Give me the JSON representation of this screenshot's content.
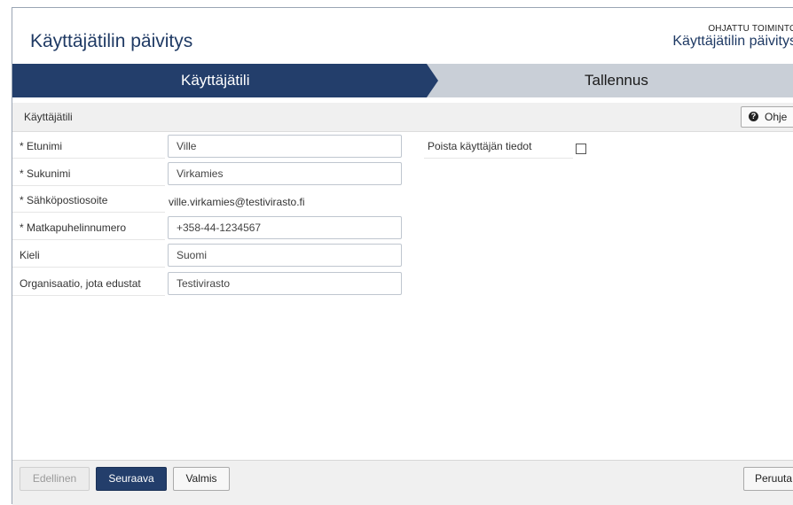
{
  "header": {
    "title": "Käyttäjätilin päivitys",
    "guided_label": "OHJATTU TOIMINTO",
    "guided_subtitle": "Käyttäjätilin päivitys"
  },
  "steps": [
    {
      "label": "Käyttäjätili",
      "active": true
    },
    {
      "label": "Tallennus",
      "active": false
    }
  ],
  "section": {
    "label": "Käyttäjätili",
    "help_label": "Ohje"
  },
  "form": {
    "first_name": {
      "label": "* Etunimi",
      "value": "Ville"
    },
    "last_name": {
      "label": "* Sukunimi",
      "value": "Virkamies"
    },
    "email": {
      "label": "* Sähköpostiosoite",
      "value": "ville.virkamies@testivirasto.fi"
    },
    "mobile": {
      "label": "* Matkapuhelinnumero",
      "value": "+358-44-1234567"
    },
    "language": {
      "label": "Kieli",
      "value": "Suomi"
    },
    "organization": {
      "label": "Organisaatio, jota edustat",
      "value": "Testivirasto"
    },
    "delete_user": {
      "label": "Poista käyttäjän tiedot",
      "checked": false
    }
  },
  "footer": {
    "prev_label": "Edellinen",
    "next_label": "Seuraava",
    "done_label": "Valmis",
    "cancel_label": "Peruuta"
  },
  "colors": {
    "accent": "#233e6b",
    "title": "#1f3a64",
    "step_inactive": "#c9cfd7"
  }
}
